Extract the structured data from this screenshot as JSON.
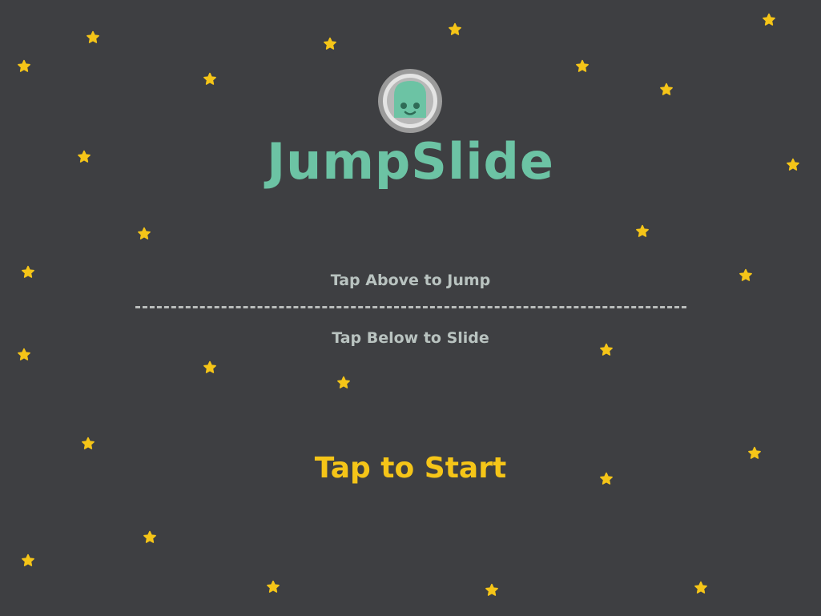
{
  "game": {
    "title": "JumpSlide",
    "instruction_jump": "Tap Above to Jump",
    "instruction_slide": "Tap Below to Slide",
    "start_prompt": "Tap to Start"
  },
  "colors": {
    "background": "#3e3f42",
    "title": "#6cc3a4",
    "hint_text": "#b9c3c0",
    "start_text": "#f5c518",
    "star": "#f5c518",
    "avatar_body": "#6cc3a4",
    "avatar_ring": "#a9a9a9"
  },
  "icons": {
    "logo": "ghost-avatar-icon",
    "background_decoration": "star-icon"
  }
}
